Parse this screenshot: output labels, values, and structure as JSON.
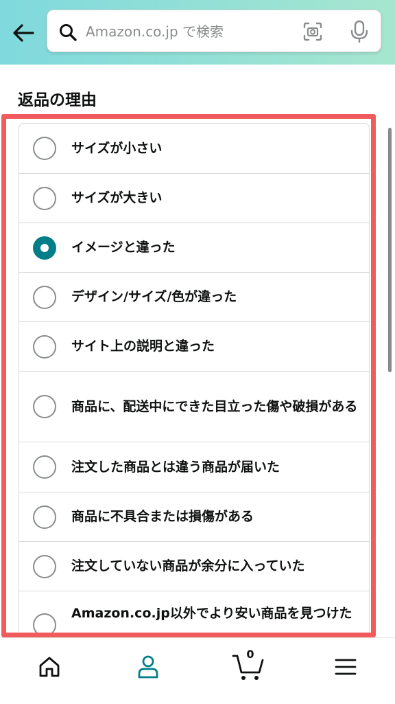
{
  "header": {
    "search": {
      "placeholder": "Amazon.co.jp で検索",
      "value": ""
    }
  },
  "section_title": "返品の理由",
  "reasons": [
    {
      "label": "サイズが小さい",
      "checked": false
    },
    {
      "label": "サイズが大きい",
      "checked": false
    },
    {
      "label": "イメージと違った",
      "checked": true
    },
    {
      "label": "デザイン/サイズ/色が違った",
      "checked": false
    },
    {
      "label": "サイト上の説明と違った",
      "checked": false
    },
    {
      "label": "商品に、配送中にできた目立った傷や破損がある",
      "checked": false
    },
    {
      "label": "注文した商品とは違う商品が届いた",
      "checked": false
    },
    {
      "label": "商品に不具合または損傷がある",
      "checked": false
    },
    {
      "label": "注文していない商品が余分に入っていた",
      "checked": false
    },
    {
      "label": "Amazon.co.jp以外でより安い商品を見つけた",
      "checked": false
    }
  ],
  "bottom_nav": {
    "items": [
      {
        "icon": "home-icon"
      },
      {
        "icon": "account-icon"
      },
      {
        "icon": "cart-icon"
      },
      {
        "icon": "menu-icon"
      }
    ],
    "cart_count": "0"
  },
  "colors": {
    "accent": "#017e88",
    "highlight_border": "#f25b5d",
    "header_gradient_start": "#7fd9dd",
    "header_gradient_end": "#a6e6cf"
  }
}
